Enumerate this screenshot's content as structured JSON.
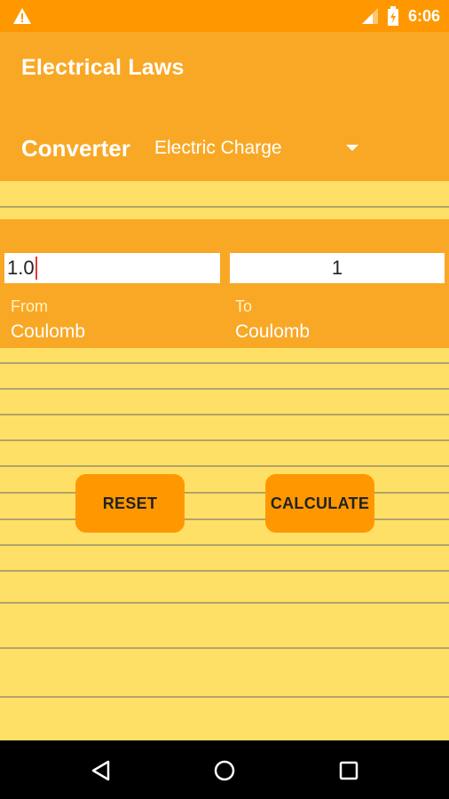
{
  "status_bar": {
    "time": "6:06",
    "icons": [
      "warning-icon",
      "signal-icon",
      "battery-icon"
    ]
  },
  "app_bar": {
    "title": "Electrical Laws"
  },
  "converter": {
    "label": "Converter",
    "selected_quantity": "Electric Charge"
  },
  "conversion": {
    "from_value": "1.0",
    "to_value": "1",
    "from_label": "From",
    "to_label": "To",
    "from_unit": "Coulomb",
    "to_unit": "Coulomb"
  },
  "buttons": {
    "reset": "RESET",
    "calculate": "CALCULATE"
  },
  "nav": {
    "icons": [
      "back-icon",
      "home-icon",
      "recents-icon"
    ]
  },
  "colors": {
    "status_bar": "#ff9800",
    "app_bar": "#f9a825",
    "background": "#ffe066",
    "button": "#ff9800"
  }
}
